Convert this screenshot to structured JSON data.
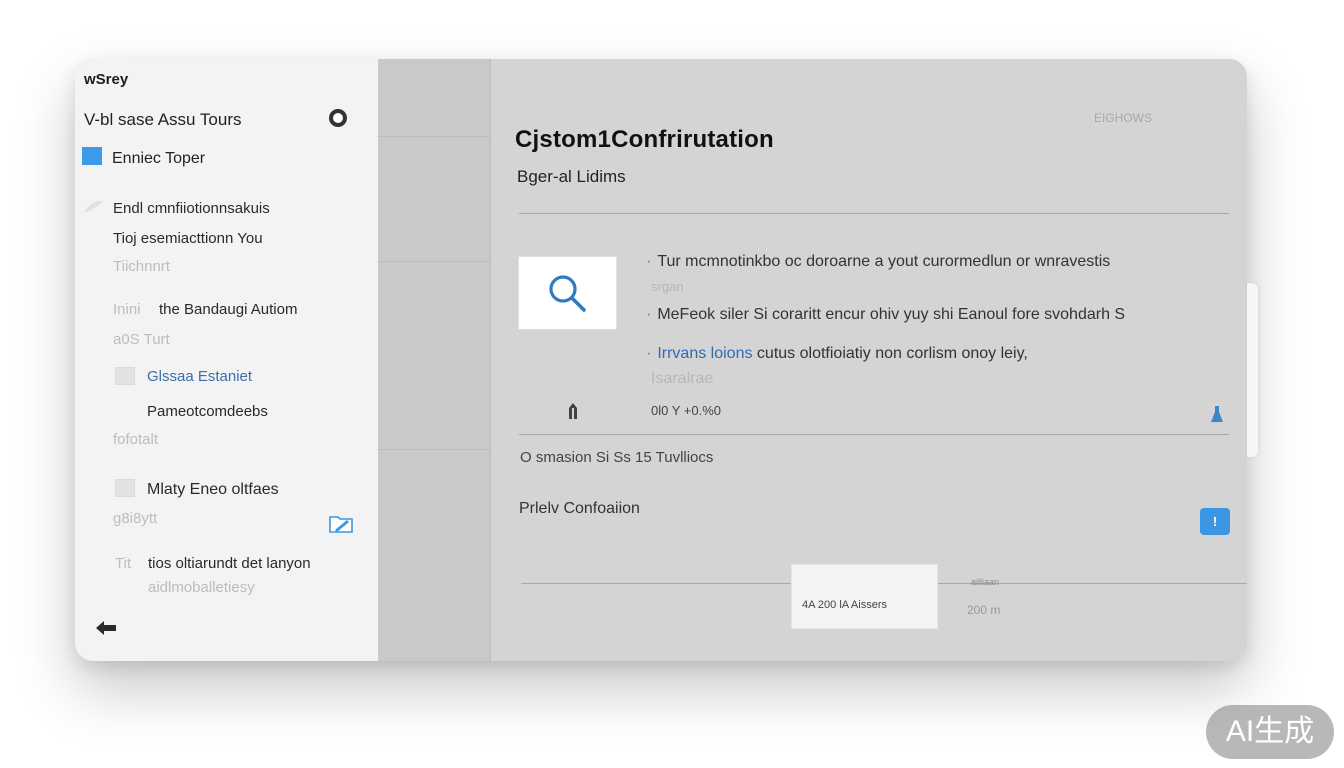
{
  "sidebar": {
    "title": "wSrey",
    "subtitle": "V-bl sase  Assu Tours",
    "topic": "Enniec Toper",
    "items": [
      {
        "text": "Endl cmnfiiotionnsakuis",
        "faint": ""
      },
      {
        "text": "Tioj esemiacttionn You",
        "faint": "Tiichnnrt"
      },
      {
        "text": "the Bandaugi Autiom",
        "prefix": "Inini",
        "faint": "a0S Turt"
      },
      {
        "text": "Glssaa Estaniet",
        "faint": ""
      },
      {
        "text": "Pameotcomdeebs",
        "faint": "fofotalt"
      },
      {
        "text": "Mlaty Eneo oltfaes",
        "faint": "g8i8ytt"
      },
      {
        "text": "tios oltiarundt det lanyon",
        "prefix": "Tit",
        "faint": "aidlmoballetiesy"
      }
    ]
  },
  "main": {
    "title": "Cjstom1Confrirutation",
    "subtitle": "Bger-al Lidims",
    "corner_label": "EIGHOWS",
    "bullets": [
      {
        "text": "Tur mcmnotinkbo oc doroarne a yout curormedlun or wnravestis",
        "faint": "srgan"
      },
      {
        "text": "MeFeok siler  Si coraritt encur ohiv yuy shi Eanoul fore svohdarh S",
        "faint": ""
      },
      {
        "link": "Irrvans loions",
        "text": " cutus olotfioiatiy non corlism onoy leiy,",
        "faint": "Isaralrae"
      }
    ],
    "readout": "0l0 Y  +0.%0",
    "line1": "O smasion Si Ss 15 Tuvlliocs",
    "line2": "Prlelv Confoaiion",
    "info_label": "!",
    "card": {
      "text": "4A   200 lA  Aissers",
      "side": "200 m",
      "top": "ailliaan"
    }
  },
  "watermark": "AI生成"
}
